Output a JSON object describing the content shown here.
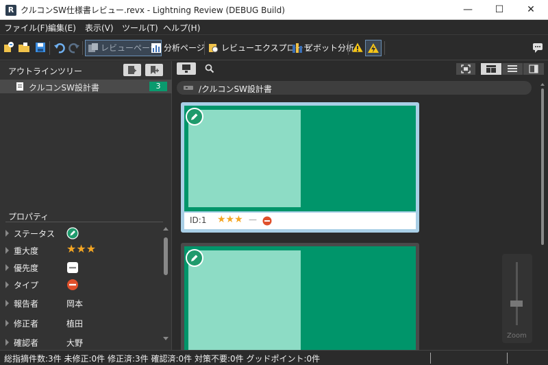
{
  "window": {
    "title": "クルコンSW仕様書レビュー.revx  - Lightning Review (DEBUG Build)",
    "minimize": "—",
    "maximize": "☐",
    "close": "✕"
  },
  "menu": [
    "ファイル(F)",
    "編集(E)",
    "表示(V)",
    "ツール(T)",
    "ヘルプ(H)"
  ],
  "toolbar": {
    "review_page": "レビューページ",
    "analysis_page": "分析ページ",
    "review_explorer": "レビューエクスプローラ",
    "pivot_analysis": "ピボット分析"
  },
  "outline": {
    "title": "アウトラインツリー",
    "doc_name": "クルコンSW設計書",
    "doc_count": "3"
  },
  "properties": {
    "title": "プロパティ",
    "rows": [
      {
        "label": "ステータス"
      },
      {
        "label": "重大度"
      },
      {
        "label": "優先度"
      },
      {
        "label": "タイプ"
      },
      {
        "label": "報告者",
        "value": "岡本"
      },
      {
        "label": "修正者",
        "value": "植田"
      },
      {
        "label": "確認者",
        "value": "大野"
      }
    ],
    "severity_stars": "★★★"
  },
  "viewer": {
    "path": "/クルコンSW設計書",
    "card1_id": "ID:1",
    "card1_stars": "★★★",
    "card1_dash": "—",
    "zoom_label": "Zoom"
  },
  "status": {
    "text": "総指摘件数:3件  未修正:0件  修正済:3件  確認済:0件  対策不要:0件  グッドポイント:0件"
  },
  "colors": {
    "accent_green": "#00956a",
    "thumb_green": "#8ddcc5",
    "badge_green": "#1f9a6c",
    "priority_red": "#e0502b",
    "star_orange": "#f5a623"
  }
}
